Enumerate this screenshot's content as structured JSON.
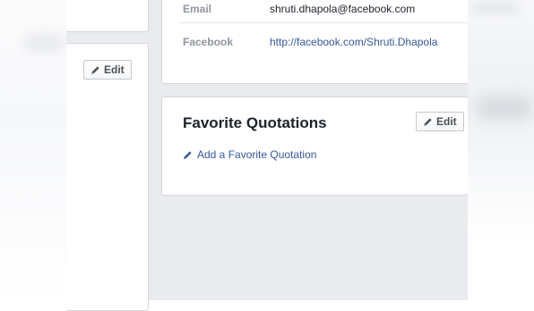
{
  "contact": {
    "email_label": "Email",
    "email_value": "shruti.dhapola@facebook.com",
    "facebook_label": "Facebook",
    "facebook_value": "http://facebook.com/Shruti.Dhapola"
  },
  "left_panel": {
    "edit_label": "Edit"
  },
  "quotations": {
    "title": "Favorite Quotations",
    "edit_label": "Edit",
    "add_label": "Add a Favorite Quotation"
  },
  "icons": {
    "edit": "pencil-icon",
    "add": "pencil-icon"
  },
  "colors": {
    "link": "#365899",
    "background": "#e9ebee",
    "label": "#90949c"
  }
}
